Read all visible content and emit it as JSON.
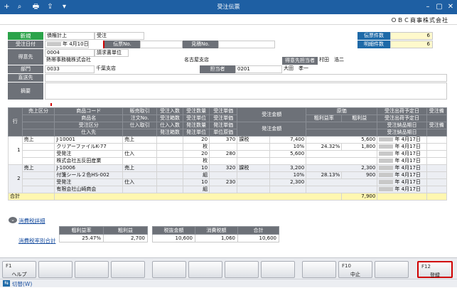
{
  "window": {
    "title": "受注伝票",
    "company": "ＯＢＣ商事株式会社"
  },
  "toolbar": {
    "add": "+",
    "search": "⌕",
    "print": "🖶",
    "export": "⇪",
    "menu": "▾"
  },
  "header": {
    "new_badge": "新規",
    "type_value": "債権計上",
    "type2_value": "受注",
    "order_date_label": "受注日付",
    "order_date_value": "年 4月10日",
    "slip_no_label": "伝票No.",
    "estimate_no_label": "見積No.",
    "customer_label": "得意先",
    "customer_code": "0004",
    "billing_value": "請求書単位",
    "customer_name": "熱帯事務機株式会社",
    "branch_name": "名古屋支店",
    "contact_label": "得意先担当者",
    "contact_name": "村田　浩二",
    "dept_label": "部門",
    "dept_code": "0033",
    "dept_name": "千葉支店",
    "staff_label": "担当者",
    "staff_code": "0201",
    "staff_name": "大田　孝一",
    "ship_label": "直送先",
    "memo_label": "摘要",
    "slip_count_label": "伝票件数",
    "slip_count_value": "6",
    "detail_count_label": "明細件数",
    "detail_count_value": "6"
  },
  "grid": {
    "h_row": "行",
    "h1": [
      "売上区分",
      "商品コード",
      "販売取引",
      "受注入数",
      "受注数量",
      "受注単価",
      "受注金額",
      "原価",
      "受注出荷予定日",
      "受注備"
    ],
    "h2": [
      "",
      "商品名",
      "注文No.",
      "受注箱数",
      "受注単位",
      "受注単価",
      "",
      "粗利益率",
      "粗利益",
      "受注出荷予定日"
    ],
    "h3": [
      "",
      "受注区分",
      "仕入取引",
      "仕入入数",
      "発注数量",
      "発注単価",
      "発注金額",
      "",
      "受注納品期日",
      "受注備"
    ],
    "h4": [
      "",
      "仕入先",
      "",
      "発注箱数",
      "発注単位",
      "単位原価",
      "",
      "",
      "受注納品期日",
      ""
    ],
    "rows": [
      {
        "no": "1",
        "kubun": "売上",
        "code": "J-10001",
        "torihiki": "売上",
        "qty": "20",
        "price": "370",
        "tax": "課税",
        "amount": "7,400",
        "cost": "5,600",
        "date1": "年 4月17日",
        "name": "クリアーファイルK-77",
        "unit": "枚",
        "rate": "10%",
        "margin_rate": "24.32%",
        "margin": "1,800",
        "date2": "年 4月17日",
        "jkubun": "受発注",
        "shiire": "仕入",
        "pqty": "20",
        "pprice": "280",
        "pamount": "5,600",
        "date3": "年 4月17日",
        "supplier": "株式会社五反田産業",
        "punit": "枚",
        "date4": "年 4月17日"
      },
      {
        "no": "2",
        "kubun": "売上",
        "code": "J-10006",
        "torihiki": "売上",
        "qty": "10",
        "price": "320",
        "tax": "課税",
        "amount": "3,200",
        "cost": "2,300",
        "date1": "年 4月17日",
        "name": "付箋シール２色HS-002",
        "unit": "組",
        "rate": "10%",
        "margin_rate": "28.13%",
        "margin": "900",
        "date2": "年 4月17日",
        "jkubun": "受発注",
        "shiire": "仕入",
        "pqty": "10",
        "pprice": "230",
        "pamount": "2,300",
        "date3": "年 4月17日",
        "supplier": "有限会社山崎商会",
        "punit": "組",
        "date4": "年 4月17日"
      }
    ],
    "total_label": "合計",
    "total_amount": "7,900"
  },
  "tax": {
    "detail_link": "消費税詳細",
    "rate_link": "消費税率別合計",
    "h_margin_rate": "粗利益率",
    "h_margin": "粗利益",
    "margin_rate": "25.47%",
    "margin": "2,700",
    "h_taxable": "税抜金額",
    "h_tax": "消費税額",
    "h_total": "合計",
    "taxable": "10,600",
    "tax": "1,060",
    "total": "10,600"
  },
  "fkeys": [
    {
      "n": "F1",
      "l": "ヘルプ"
    },
    {
      "n": "",
      "l": ""
    },
    {
      "n": "",
      "l": ""
    },
    {
      "n": "",
      "l": ""
    },
    {
      "n": "",
      "l": ""
    },
    {
      "n": "",
      "l": ""
    },
    {
      "n": "",
      "l": ""
    },
    {
      "n": "",
      "l": ""
    },
    {
      "n": "",
      "l": ""
    },
    {
      "n": "F10",
      "l": "中止"
    },
    {
      "n": "",
      "l": ""
    },
    {
      "n": "F12",
      "l": "登録"
    }
  ],
  "status": {
    "switch_label": "切替(W)"
  },
  "colors": {
    "title": "#1e5fa3",
    "highlight": "#d00000",
    "new_badge": "#2ba34a"
  }
}
